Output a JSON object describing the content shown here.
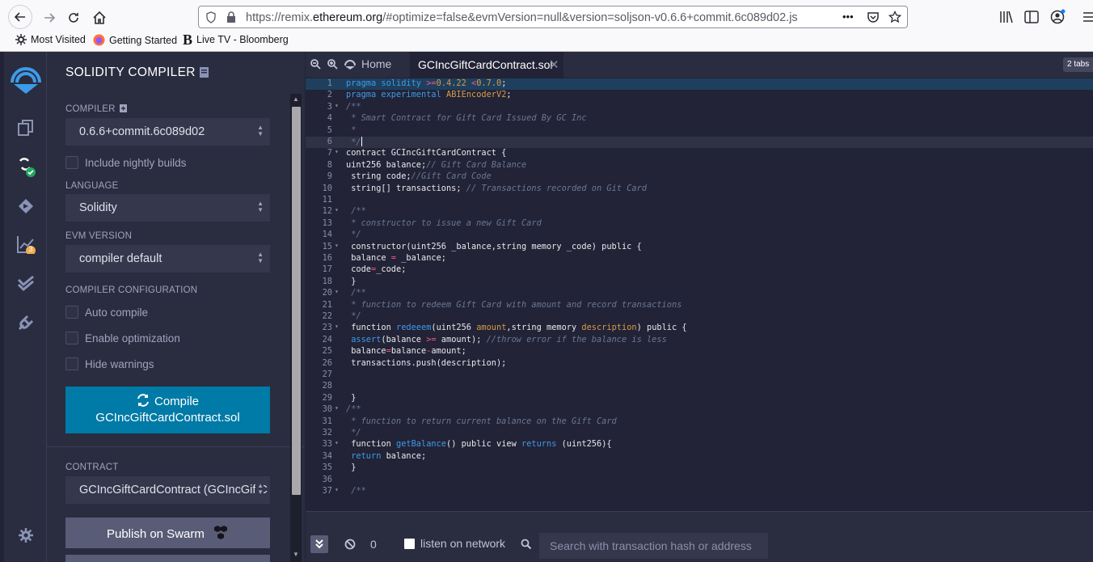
{
  "browser": {
    "url_prefix": "https://remix.",
    "url_domain": "ethereum.org",
    "url_rest": "/#optimize=false&evmVersion=null&version=soljson-v0.6.6+commit.6c089d02.js",
    "more": "•••",
    "bookmarks": [
      "Most Visited",
      "Getting Started",
      "Live TV - Bloomberg"
    ],
    "bloomberg_logo": "B"
  },
  "icons": {
    "analysis_badge": "3"
  },
  "sidebar": {
    "title": "SOLIDITY COMPILER",
    "compiler_label": "COMPILER",
    "compiler_value": "0.6.6+commit.6c089d02",
    "nightly": "Include nightly builds",
    "language_label": "LANGUAGE",
    "language_value": "Solidity",
    "evm_label": "EVM VERSION",
    "evm_value": "compiler default",
    "config_label": "COMPILER CONFIGURATION",
    "auto_compile": "Auto compile",
    "optimization": "Enable optimization",
    "hide_warnings": "Hide warnings",
    "compile_line1": "Compile",
    "compile_line2": "GCIncGiftCardContract.sol",
    "contract_label": "CONTRACT",
    "contract_value": "GCIncGiftCardContract (GCIncGiftC",
    "publish": "Publish on Swarm"
  },
  "editor": {
    "home_tab": "Home",
    "file_tab": "GCIncGiftCardContract.sol",
    "tabs_badge": "2 tabs",
    "lines": [
      {
        "n": "1",
        "f": "",
        "h": "<span class='k'>pragma</span> <span class='k'>solidity</span> <span class='op'>&gt;=</span><span class='v'>0.4.22</span> <span class='op'>&lt;</span><span class='v'>0.7.0</span>;"
      },
      {
        "n": "2",
        "f": "",
        "h": "<span class='k'>pragma</span> <span class='k'>experimental</span> <span class='v'>ABIEncoderV2</span>;"
      },
      {
        "n": "3",
        "f": "▾",
        "h": "<span class='cm'>/**</span>"
      },
      {
        "n": "4",
        "f": "",
        "h": "<span class='cm'> * Smart Contract for Gift Card Issued By GC Inc</span>"
      },
      {
        "n": "5",
        "f": "",
        "h": "<span class='cm'> *</span>"
      },
      {
        "n": "6",
        "f": "",
        "h": "<span class='cm'> */</span>"
      },
      {
        "n": "7",
        "f": "▾",
        "h": "contract GCIncGiftCardContract {"
      },
      {
        "n": "8",
        "f": "",
        "h": "uint256 balance;<span class='cm'>// Gift Card Balance</span>"
      },
      {
        "n": "9",
        "f": "",
        "h": " string code;<span class='cm'>//Gift Card Code</span>"
      },
      {
        "n": "10",
        "f": "",
        "h": " string[] transactions; <span class='cm'>// Transactions recorded on Git Card</span>"
      },
      {
        "n": "11",
        "f": "",
        "h": ""
      },
      {
        "n": "12",
        "f": "▾",
        "h": " <span class='cm'>/**</span>"
      },
      {
        "n": "13",
        "f": "",
        "h": "<span class='cm'> * constructor to issue a new Gift Card</span>"
      },
      {
        "n": "14",
        "f": "",
        "h": "<span class='cm'> */</span>"
      },
      {
        "n": "15",
        "f": "▾",
        "h": " constructor(uint256 _balance,string memory _code) public {"
      },
      {
        "n": "16",
        "f": "",
        "h": " balance <span class='op'>=</span> _balance;"
      },
      {
        "n": "17",
        "f": "",
        "h": " code<span class='op'>=</span>_code;"
      },
      {
        "n": "18",
        "f": "",
        "h": " }"
      },
      {
        "n": "20",
        "f": "▾",
        "h": " <span class='cm'>/**</span>"
      },
      {
        "n": "21",
        "f": "",
        "h": "<span class='cm'> * function to redeem Gift Card with amount and record transactions</span>"
      },
      {
        "n": "22",
        "f": "",
        "h": "<span class='cm'> */</span>"
      },
      {
        "n": "23",
        "f": "▾",
        "h": " function <span class='f'>redeeem</span>(uint256 <span class='v'>amount</span>,string memory <span class='v'>description</span>) public {"
      },
      {
        "n": "24",
        "f": "",
        "h": " <span class='k'>assert</span>(balance <span class='op'>&gt;=</span> amount); <span class='cm'>//throw error if the balance is less</span>"
      },
      {
        "n": "25",
        "f": "",
        "h": " balance<span class='op'>=</span>balance<span class='op'>-</span>amount;"
      },
      {
        "n": "26",
        "f": "",
        "h": " transactions.push(description);"
      },
      {
        "n": "27",
        "f": "",
        "h": ""
      },
      {
        "n": "28",
        "f": "",
        "h": ""
      },
      {
        "n": "29",
        "f": "",
        "h": " }"
      },
      {
        "n": "30",
        "f": "▾",
        "h": "<span class='cm'>/**</span>"
      },
      {
        "n": "31",
        "f": "",
        "h": "<span class='cm'> * function to return current balance on the Gift Card</span>"
      },
      {
        "n": "32",
        "f": "",
        "h": "<span class='cm'> */</span>"
      },
      {
        "n": "33",
        "f": "▾",
        "h": " function <span class='f'>getBalance</span>() public view <span class='k'>returns</span> (uint256){"
      },
      {
        "n": "34",
        "f": "",
        "h": " <span class='k'>return</span> balance;"
      },
      {
        "n": "35",
        "f": "",
        "h": " }"
      },
      {
        "n": "36",
        "f": "",
        "h": ""
      },
      {
        "n": "37",
        "f": "▾",
        "h": " <span class='cm'>/**</span>"
      }
    ]
  },
  "terminal": {
    "count": "0",
    "listen": "listen on network",
    "search_placeholder": "Search with transaction hash or address"
  }
}
